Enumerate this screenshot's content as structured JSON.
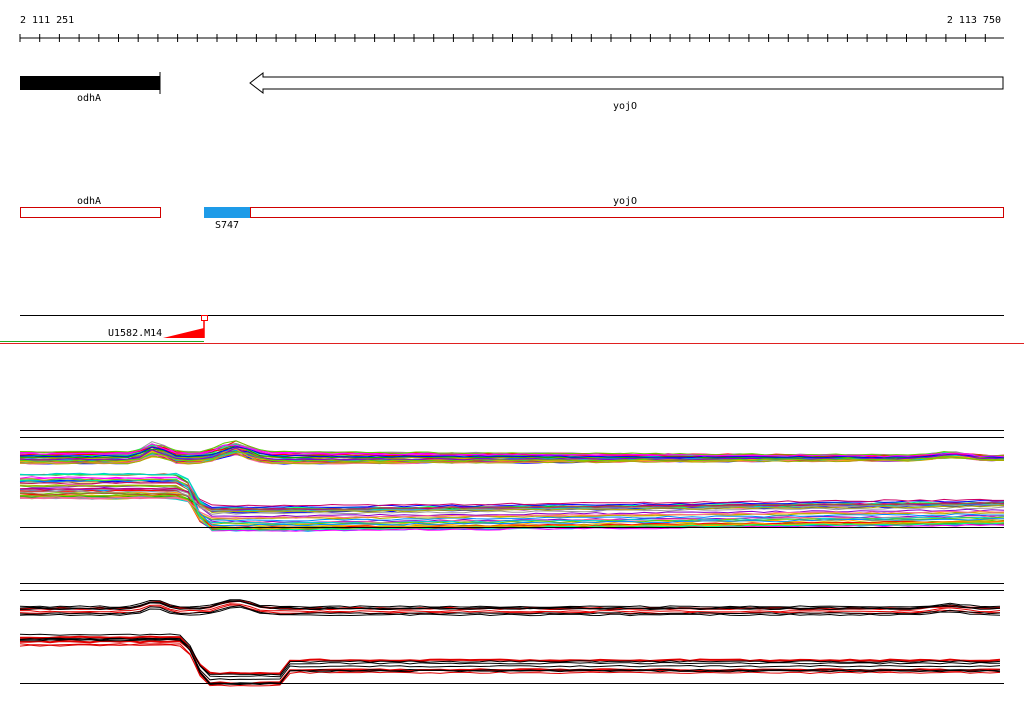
{
  "ruler": {
    "start": "2 111 251",
    "end": "2 113 750"
  },
  "genes": [
    {
      "name": "odhA",
      "strand": "forward",
      "color": "#000000"
    },
    {
      "name": "yojO",
      "strand": "reverse",
      "color": "#ffffff"
    }
  ],
  "annotations": [
    {
      "name": "odhA",
      "color": "#d00000"
    },
    {
      "name": "yojO",
      "color": "#d00000"
    }
  ],
  "feature": {
    "name": "S747",
    "color": "#1e9be8"
  },
  "marker": {
    "name": "U1582.M14",
    "color": "#ff0000"
  },
  "colors": {
    "axis": "#000000",
    "annotation_outline": "#d00000",
    "trace_highlight": "#e00000"
  }
}
